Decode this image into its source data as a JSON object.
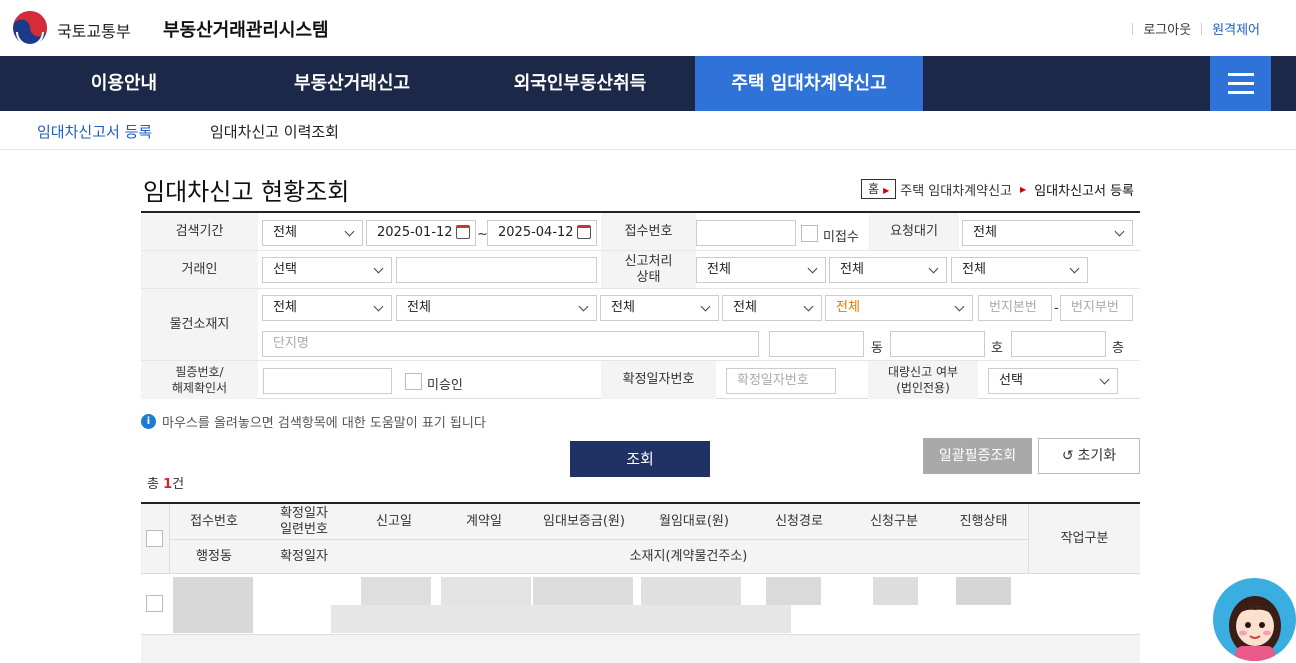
{
  "header": {
    "ministry": "국토교통부",
    "system_title": "부동산거래관리시스템",
    "logout": "로그아웃",
    "remote": "원격제어"
  },
  "gnb": {
    "items": [
      "이용안내",
      "부동산거래신고",
      "외국인부동산취득",
      "주택 임대차계약신고"
    ],
    "active_index": 3
  },
  "subnav": {
    "items": [
      "임대차신고서 등록",
      "임대차신고 이력조회"
    ],
    "active_index": 0
  },
  "page": {
    "title": "임대차신고 현황조회",
    "breadcrumb": [
      "홈",
      "주택 임대차계약신고",
      "임대차신고서 등록"
    ]
  },
  "form": {
    "period_label": "검색기간",
    "period_select": "전체",
    "date_from": "2025-01-12",
    "tilde": "~",
    "date_to": "2025-04-12",
    "receipt_no_label": "접수번호",
    "unreceived_label": "미접수",
    "request_wait_label": "요청대기",
    "request_wait_select": "전체",
    "party_label": "거래인",
    "party_select": "선택",
    "status_label": "신고처리\n상태",
    "status_selects": [
      "전체",
      "전체",
      "전체"
    ],
    "location_label": "물건소재지",
    "location_selects": [
      "전체",
      "전체",
      "전체",
      "전체",
      "전체"
    ],
    "lot_main_placeholder": "번지본번",
    "dash": "-",
    "lot_sub_placeholder": "번지부번",
    "complex_placeholder": "단지명",
    "dong_label": "동",
    "ho_label": "호",
    "floor_label": "층",
    "cert_label": "필증번호/\n해제확인서",
    "unapproved_label": "미승인",
    "confirm_no_label": "확정일자번호",
    "confirm_no_placeholder": "확정일자번호",
    "bulk_label": "대량신고 여부\n(법인전용)",
    "bulk_select": "선택"
  },
  "help_text": "마우스를 올려놓으면 검색항목에 대한 도움말이 표기 됩니다",
  "buttons": {
    "search": "조회",
    "bulk_cert": "일괄필증조회",
    "reset": "초기화"
  },
  "total": {
    "prefix": "총 ",
    "count": "1",
    "suffix": "건"
  },
  "table": {
    "row1_headers": [
      "접수번호",
      "확정일자\n일련번호",
      "신고일",
      "계약일",
      "임대보증금(원)",
      "월임대료(원)",
      "신청경로",
      "신청구분",
      "진행상태"
    ],
    "row2_headers": [
      "행정동",
      "확정일자",
      "소재지(계약물건주소)"
    ],
    "work_header": "작업구분"
  },
  "colors": {
    "gnb_bg": "#1b2848",
    "gnb_active": "#2f73d8",
    "search_button": "#1f3263",
    "link_blue": "#1e5fc1"
  }
}
